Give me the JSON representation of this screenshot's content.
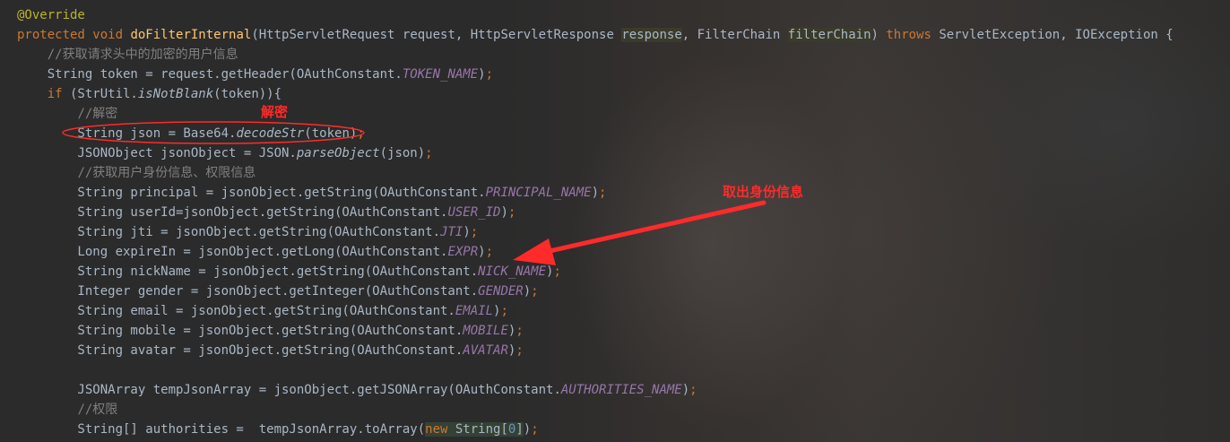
{
  "code": {
    "lines": [
      [
        {
          "t": "@Override",
          "c": "ann"
        }
      ],
      [
        {
          "t": "protected",
          "c": "kw"
        },
        {
          "t": " "
        },
        {
          "t": "void",
          "c": "kw"
        },
        {
          "t": " "
        },
        {
          "t": "doFilterInternal",
          "c": "fn"
        },
        {
          "t": "(HttpServletRequest request, HttpServletResponse "
        },
        {
          "t": "response",
          "c": "hl"
        },
        {
          "t": ", FilterChain "
        },
        {
          "t": "filterChain",
          "c": "hl"
        },
        {
          "t": ") "
        },
        {
          "t": "throws",
          "c": "kw"
        },
        {
          "t": " ServletException, IOException {"
        }
      ],
      [
        {
          "t": "    "
        },
        {
          "t": "//获取请求头中的加密的用户信息",
          "c": "cm"
        }
      ],
      [
        {
          "t": "    String token = request.getHeader(OAuthConstant."
        },
        {
          "t": "TOKEN_NAME",
          "c": "st"
        },
        {
          "t": ")"
        },
        {
          "t": ";",
          "c": "kw"
        }
      ],
      [
        {
          "t": "    "
        },
        {
          "t": "if",
          "c": "kw"
        },
        {
          "t": " (StrUtil."
        },
        {
          "t": "isNotBlank",
          "c": "it"
        },
        {
          "t": "(token)){"
        }
      ],
      [
        {
          "t": "        "
        },
        {
          "t": "//解密",
          "c": "cm"
        }
      ],
      [
        {
          "t": "        String json = Base64."
        },
        {
          "t": "decodeStr",
          "c": "it"
        },
        {
          "t": "(token)"
        },
        {
          "t": ";",
          "c": "kw"
        }
      ],
      [
        {
          "t": "        JSONObject jsonObject = JSON."
        },
        {
          "t": "parseObject",
          "c": "it"
        },
        {
          "t": "(json)"
        },
        {
          "t": ";",
          "c": "kw"
        }
      ],
      [
        {
          "t": "        "
        },
        {
          "t": "//获取用户身份信息、权限信息",
          "c": "cm"
        }
      ],
      [
        {
          "t": "        String principal = jsonObject.getString(OAuthConstant."
        },
        {
          "t": "PRINCIPAL_NAME",
          "c": "st"
        },
        {
          "t": ")"
        },
        {
          "t": ";",
          "c": "kw"
        }
      ],
      [
        {
          "t": "        String userId=jsonObject.getString(OAuthConstant."
        },
        {
          "t": "USER_ID",
          "c": "st"
        },
        {
          "t": ")"
        },
        {
          "t": ";",
          "c": "kw"
        }
      ],
      [
        {
          "t": "        String jti = jsonObject.getString(OAuthConstant."
        },
        {
          "t": "JTI",
          "c": "st"
        },
        {
          "t": ")"
        },
        {
          "t": ";",
          "c": "kw"
        }
      ],
      [
        {
          "t": "        Long expireIn = jsonObject.getLong(OAuthConstant."
        },
        {
          "t": "EXPR",
          "c": "st"
        },
        {
          "t": ")"
        },
        {
          "t": ";",
          "c": "kw"
        }
      ],
      [
        {
          "t": "        String nickName = jsonObject.getString(OAuthConstant."
        },
        {
          "t": "NICK_NAME",
          "c": "st"
        },
        {
          "t": ")"
        },
        {
          "t": ";",
          "c": "kw"
        }
      ],
      [
        {
          "t": "        Integer gender = jsonObject.getInteger(OAuthConstant."
        },
        {
          "t": "GENDER",
          "c": "st"
        },
        {
          "t": ")"
        },
        {
          "t": ";",
          "c": "kw"
        }
      ],
      [
        {
          "t": "        String email = jsonObject.getString(OAuthConstant."
        },
        {
          "t": "EMAIL",
          "c": "st"
        },
        {
          "t": ")"
        },
        {
          "t": ";",
          "c": "kw"
        }
      ],
      [
        {
          "t": "        String mobile = jsonObject.getString(OAuthConstant."
        },
        {
          "t": "MOBILE",
          "c": "st"
        },
        {
          "t": ")"
        },
        {
          "t": ";",
          "c": "kw"
        }
      ],
      [
        {
          "t": "        String avatar = jsonObject.getString(OAuthConstant."
        },
        {
          "t": "AVATAR",
          "c": "st"
        },
        {
          "t": ")"
        },
        {
          "t": ";",
          "c": "kw"
        }
      ],
      [
        {
          "t": ""
        }
      ],
      [
        {
          "t": "        JSONArray tempJsonArray = jsonObject.getJSONArray(OAuthConstant."
        },
        {
          "t": "AUTHORITIES_NAME",
          "c": "st"
        },
        {
          "t": ")"
        },
        {
          "t": ";",
          "c": "kw"
        }
      ],
      [
        {
          "t": "        "
        },
        {
          "t": "//权限",
          "c": "cm"
        }
      ],
      [
        {
          "t": "        String[] authorities =  tempJsonArray.toArray("
        },
        {
          "t": "new",
          "c": "kw hl2"
        },
        {
          "t": " String[",
          "c": "hl2"
        },
        {
          "t": "0",
          "c": "num hl2"
        },
        {
          "t": "]",
          "c": "hl2"
        },
        {
          "t": ")"
        },
        {
          "t": ";",
          "c": "kw"
        }
      ]
    ]
  },
  "annotations": {
    "decrypt_label": "解密",
    "identity_label": "取出身份信息",
    "color": "#ff2a2a"
  }
}
